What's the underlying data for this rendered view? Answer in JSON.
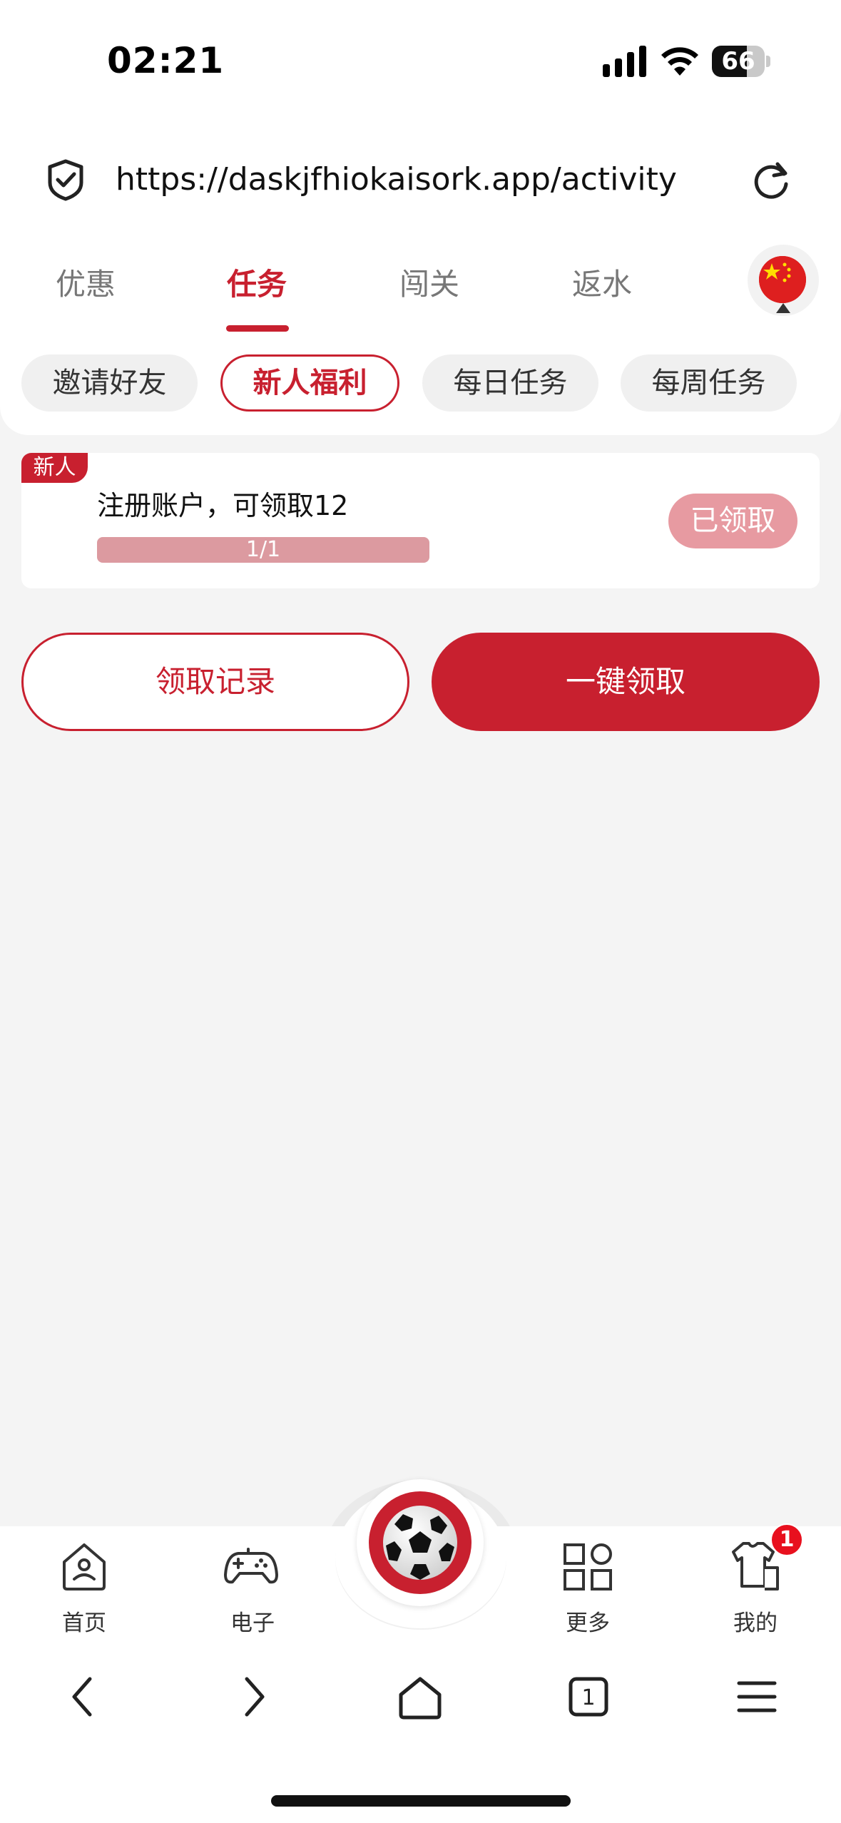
{
  "status_bar": {
    "time": "02:21",
    "battery": "66",
    "battery_level": 0.66
  },
  "browser": {
    "url": "https://daskjfhiokaisork.app/activity"
  },
  "tabs": [
    {
      "label": "优惠"
    },
    {
      "label": "任务"
    },
    {
      "label": "闯关"
    },
    {
      "label": "返水"
    }
  ],
  "active_tab": "任务",
  "chips": [
    {
      "label": "邀请好友"
    },
    {
      "label": "新人福利"
    },
    {
      "label": "每日任务"
    },
    {
      "label": "每周任务"
    }
  ],
  "active_chip": "新人福利",
  "task": {
    "tag": "新人",
    "title": "注册账户，可领取12",
    "progress_text": "1/1",
    "progress": 1.0,
    "status_button": "已领取"
  },
  "actions": {
    "history": "领取记录",
    "claim_all": "一键领取"
  },
  "bottom_nav": [
    {
      "label": "首页",
      "icon": "home-icon"
    },
    {
      "label": "电子",
      "icon": "gamepad-icon"
    },
    {
      "label": "更多",
      "icon": "grid-icon"
    },
    {
      "label": "我的",
      "icon": "clothes-icon"
    }
  ],
  "center_button_icon": "soccer-ball-icon",
  "mine_badge": "1",
  "colors": {
    "brand": "#c8202f",
    "claimed": "#e79aa1",
    "progress": "#dc9aa0",
    "background": "#f4f4f4"
  }
}
